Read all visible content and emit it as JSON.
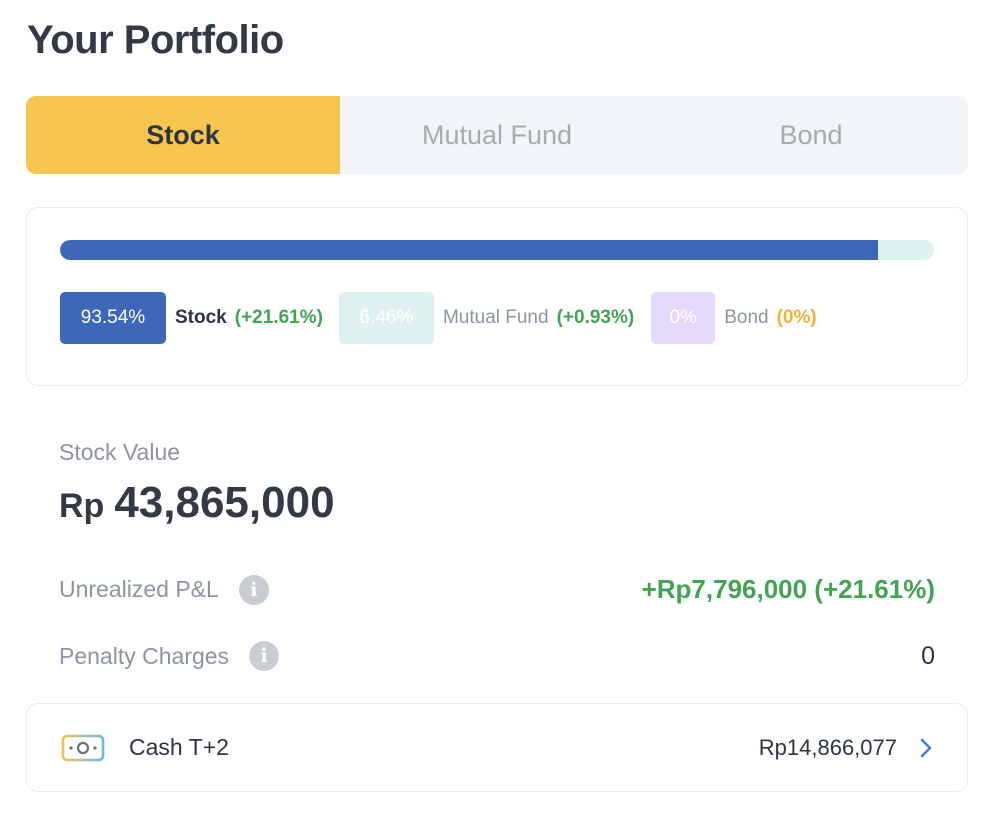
{
  "header": {
    "title": "Your Portfolio"
  },
  "tabs": [
    {
      "label": "Stock",
      "active": true
    },
    {
      "label": "Mutual Fund",
      "active": false
    },
    {
      "label": "Bond",
      "active": false
    }
  ],
  "allocation": {
    "bar_fill_percent": 93.54,
    "items": [
      {
        "pill": "93.54%",
        "name": "Stock",
        "change": "(+21.61%)"
      },
      {
        "pill": "6.46%",
        "name": "Mutual Fund",
        "change": "(+0.93%)"
      },
      {
        "pill": "0%",
        "name": "Bond",
        "change": "(0%)"
      }
    ]
  },
  "stock_value": {
    "label": "Stock Value",
    "currency": "Rp",
    "amount": "43,865,000"
  },
  "unrealized_pl": {
    "label": "Unrealized P&L",
    "value": "+Rp7,796,000 (+21.61%)"
  },
  "penalty": {
    "label": "Penalty Charges",
    "value": "0"
  },
  "cash": {
    "label": "Cash T+2",
    "value": "Rp14,866,077"
  },
  "colors": {
    "accent_tab": "#f5c54d",
    "stock_blue": "#3d67b8",
    "gain_green": "#44a353",
    "bond_orange": "#f0b23b"
  },
  "icons": [
    "info-icon",
    "cash-icon",
    "chevron-right-icon"
  ]
}
